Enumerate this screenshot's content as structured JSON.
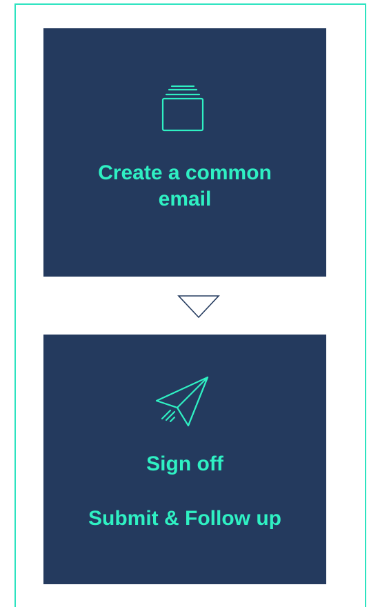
{
  "steps": [
    {
      "icon": "stacked-folders-icon",
      "title": "Create a common email"
    },
    {
      "icon": "paper-plane-icon",
      "title": "Sign off",
      "subtitle": "Submit & Follow up"
    }
  ],
  "colors": {
    "card_background": "#243a5e",
    "accent": "#2ff0c3",
    "frame_border": "#2de3c0",
    "arrow": "#243a5e"
  }
}
